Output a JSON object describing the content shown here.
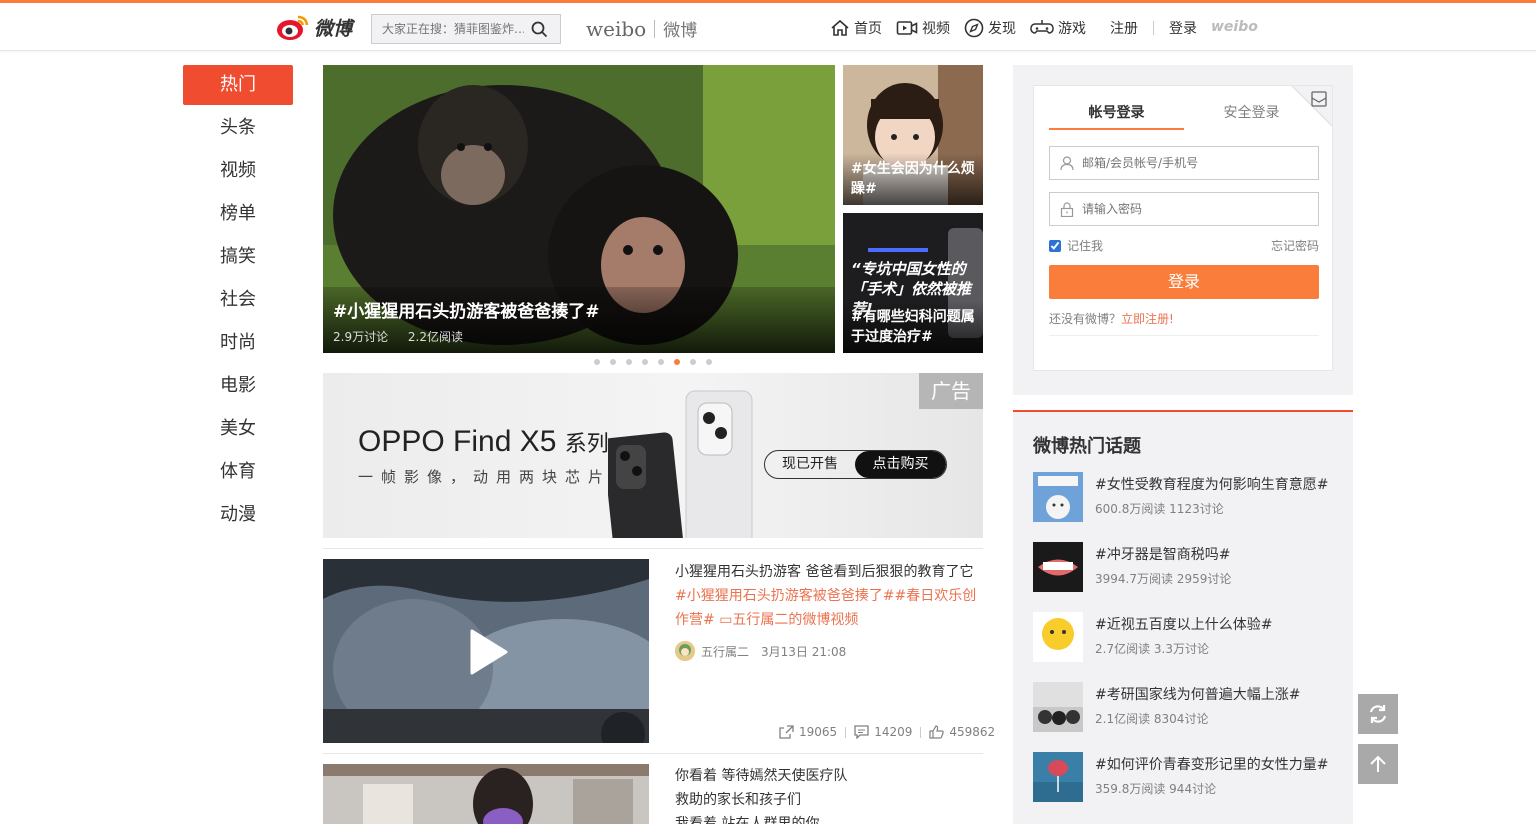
{
  "header": {
    "logo_text": "微博",
    "search_placeholder": "大家正在搜：猜菲图鉴炸…",
    "brand_en": "weibo",
    "brand_cn": "微博",
    "nav": [
      {
        "label": "首页",
        "icon": "home-icon"
      },
      {
        "label": "视频",
        "icon": "video-icon"
      },
      {
        "label": "发现",
        "icon": "discover-icon"
      },
      {
        "label": "游戏",
        "icon": "game-icon"
      }
    ],
    "register": "注册",
    "login": "登录",
    "weibo_mark": "weibo"
  },
  "leftnav": {
    "items": [
      "热门",
      "头条",
      "视频",
      "榜单",
      "搞笑",
      "社会",
      "时尚",
      "电影",
      "美女",
      "体育",
      "动漫"
    ],
    "active_index": 0
  },
  "hero": {
    "title": "#小猩猩用石头扔游客被爸爸揍了#",
    "discussions": "2.9万讨论",
    "reads": "2.2亿阅读"
  },
  "side_cards": [
    {
      "caption": "#女生会因为什么烦躁#"
    },
    {
      "quote": "“专坑中国女性的「手术」依然被推荐!",
      "caption": "#有哪些妇科问题属于过度治疗#"
    }
  ],
  "carousel": {
    "count": 8,
    "active": 5
  },
  "ad": {
    "tag": "广告",
    "title_brand": "OPPO Find X5",
    "title_suffix": "系列",
    "subtitle": "一帧影像，动用两块芯片",
    "cta_left": "现已开售",
    "cta_right": "点击购买"
  },
  "feed": [
    {
      "text": "小猩猩用石头扔游客 爸爸看到后狠狠的教育了它",
      "tags": "#小猩猩用石头扔游客被爸爸揍了##春日欢乐创作营# ",
      "video_link": "五行属二的微博视频",
      "author": "五行属二",
      "time": "3月13日 21:08",
      "shares": "19065",
      "comments": "14209",
      "likes": "459862"
    },
    {
      "lines": [
        "你看着 等待嫣然天使医疗队",
        "救助的家长和孩子们",
        "我看着 站在人群里的你"
      ]
    }
  ],
  "login": {
    "tab_account": "帐号登录",
    "tab_secure": "安全登录",
    "username_placeholder": "邮箱/会员帐号/手机号",
    "password_placeholder": "请输入密码",
    "remember": "记住我",
    "forgot": "忘记密码",
    "button": "登录",
    "no_account": "还没有微博？",
    "register_now": "立即注册!"
  },
  "topics": {
    "title": "微博热门话题",
    "items": [
      {
        "name": "#女性受教育程度为何影响生育意愿#",
        "meta": "600.8万阅读 1123讨论"
      },
      {
        "name": "#冲牙器是智商税吗#",
        "meta": "3994.7万阅读 2959讨论"
      },
      {
        "name": "#近视五百度以上什么体验#",
        "meta": "2.7亿阅读 3.3万讨论"
      },
      {
        "name": "#考研国家线为何普遍大幅上涨#",
        "meta": "2.1亿阅读 8304讨论"
      },
      {
        "name": "#如何评价青春变形记里的女性力量#",
        "meta": "359.8万阅读 944讨论"
      }
    ]
  },
  "colors": {
    "accent": "#fa7d3c",
    "hot": "#f04c30",
    "link": "#eb7350"
  }
}
